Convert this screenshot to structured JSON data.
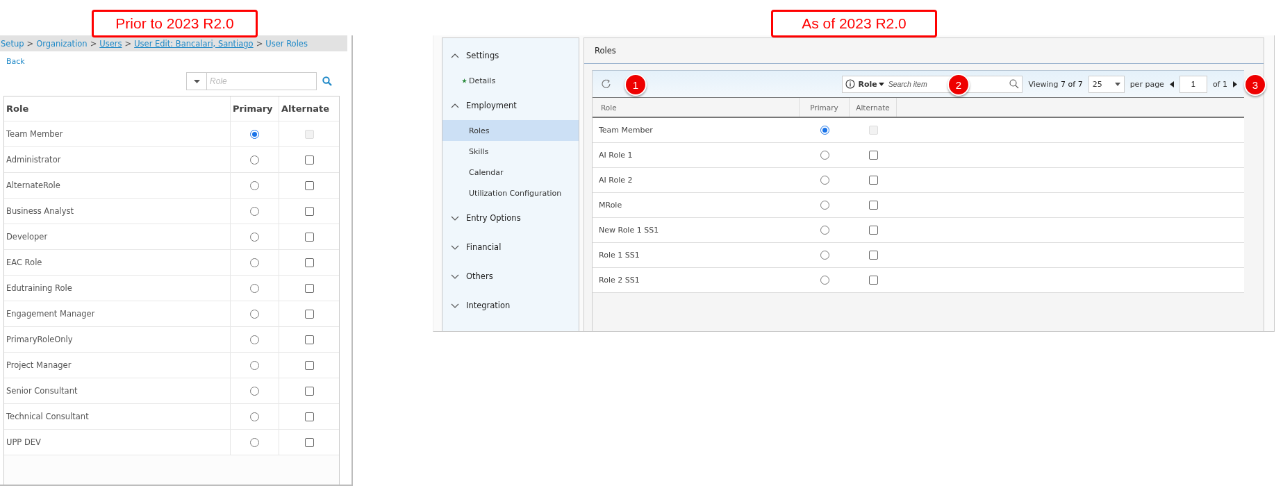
{
  "before": {
    "caption": "Prior to 2023 R2.0",
    "breadcrumb": [
      {
        "kind": "text",
        "text": "Setup"
      },
      {
        "kind": "separator",
        "text": ">"
      },
      {
        "kind": "text",
        "text": "Organization"
      },
      {
        "kind": "separator",
        "text": ">"
      },
      {
        "kind": "link",
        "text": "Users"
      },
      {
        "kind": "separator",
        "text": ">"
      },
      {
        "kind": "link",
        "text": "User Edit: Bancalari, Santiago"
      },
      {
        "kind": "separator",
        "text": ">"
      },
      {
        "kind": "text",
        "text": "User Roles"
      }
    ],
    "back": "Back",
    "search": {
      "placeholder": "Role"
    },
    "table": {
      "columns": [
        "Role",
        "Primary",
        "Alternate"
      ],
      "rows": [
        {
          "role": "Team Member",
          "primary": true,
          "alternate": false,
          "alternate_disabled": true
        },
        {
          "role": "Administrator",
          "primary": false,
          "alternate": false,
          "alternate_disabled": false
        },
        {
          "role": "AlternateRole",
          "primary": false,
          "alternate": false,
          "alternate_disabled": false
        },
        {
          "role": "Business Analyst",
          "primary": false,
          "alternate": false,
          "alternate_disabled": false
        },
        {
          "role": "Developer",
          "primary": false,
          "alternate": false,
          "alternate_disabled": false
        },
        {
          "role": "EAC Role",
          "primary": false,
          "alternate": false,
          "alternate_disabled": false
        },
        {
          "role": "Edutraining Role",
          "primary": false,
          "alternate": false,
          "alternate_disabled": false
        },
        {
          "role": "Engagement Manager",
          "primary": false,
          "alternate": false,
          "alternate_disabled": false
        },
        {
          "role": "PrimaryRoleOnly",
          "primary": false,
          "alternate": false,
          "alternate_disabled": false
        },
        {
          "role": "Project Manager",
          "primary": false,
          "alternate": false,
          "alternate_disabled": false
        },
        {
          "role": "Senior Consultant",
          "primary": false,
          "alternate": false,
          "alternate_disabled": false
        },
        {
          "role": "Technical Consultant",
          "primary": false,
          "alternate": false,
          "alternate_disabled": false
        },
        {
          "role": "UPP DEV",
          "primary": false,
          "alternate": false,
          "alternate_disabled": false
        }
      ]
    }
  },
  "after": {
    "caption": "As of 2023 R2.0",
    "sidebar": {
      "sections": [
        {
          "label": "Settings",
          "expanded": true,
          "children": [
            {
              "label": "Details",
              "required": true,
              "selected": false
            }
          ]
        },
        {
          "label": "Employment",
          "expanded": true,
          "children": [
            {
              "label": "Roles",
              "required": false,
              "selected": true
            },
            {
              "label": "Skills",
              "required": false,
              "selected": false
            },
            {
              "label": "Calendar",
              "required": false,
              "selected": false
            },
            {
              "label": "Utilization Configuration",
              "required": false,
              "selected": false
            }
          ]
        },
        {
          "label": "Entry Options",
          "expanded": false
        },
        {
          "label": "Financial",
          "expanded": false
        },
        {
          "label": "Others",
          "expanded": false
        },
        {
          "label": "Integration",
          "expanded": false
        }
      ]
    },
    "pane_title": "Roles",
    "toolbar": {
      "search_field": "Role",
      "placeholder": "Search item",
      "viewing_label": "Viewing",
      "viewing_count": "7 of 7",
      "page_size": "25",
      "per_page": "per page",
      "page": "1",
      "page_of": "of 1"
    },
    "callouts": [
      "1",
      "2",
      "3"
    ],
    "table": {
      "columns": [
        "Role",
        "Primary",
        "Alternate"
      ],
      "rows": [
        {
          "role": "Team Member",
          "primary": true,
          "alternate": false,
          "alternate_disabled": true
        },
        {
          "role": "AI Role 1",
          "primary": false,
          "alternate": false,
          "alternate_disabled": false
        },
        {
          "role": "AI Role 2",
          "primary": false,
          "alternate": false,
          "alternate_disabled": false
        },
        {
          "role": "MRole",
          "primary": false,
          "alternate": false,
          "alternate_disabled": false
        },
        {
          "role": "New Role 1 SS1",
          "primary": false,
          "alternate": false,
          "alternate_disabled": false
        },
        {
          "role": "Role 1 SS1",
          "primary": false,
          "alternate": false,
          "alternate_disabled": false
        },
        {
          "role": "Role 2 SS1",
          "primary": false,
          "alternate": false,
          "alternate_disabled": false
        }
      ]
    }
  }
}
